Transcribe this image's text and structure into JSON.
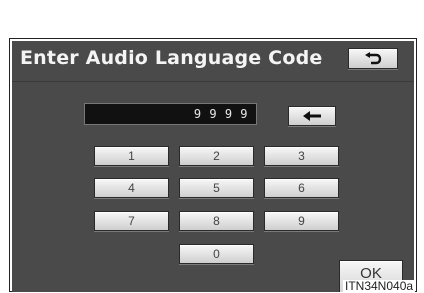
{
  "dialog": {
    "title": "Enter Audio Language Code"
  },
  "back_button": {
    "icon": "return-arrow-icon"
  },
  "code_display": {
    "value": "9 9 9 9"
  },
  "backspace_button": {
    "icon": "left-arrow-icon"
  },
  "keypad": {
    "keys": [
      "1",
      "2",
      "3",
      "4",
      "5",
      "6",
      "7",
      "8",
      "9",
      "0"
    ]
  },
  "ok_button": {
    "label": "OK"
  },
  "figure_code": "ITN34N040a"
}
